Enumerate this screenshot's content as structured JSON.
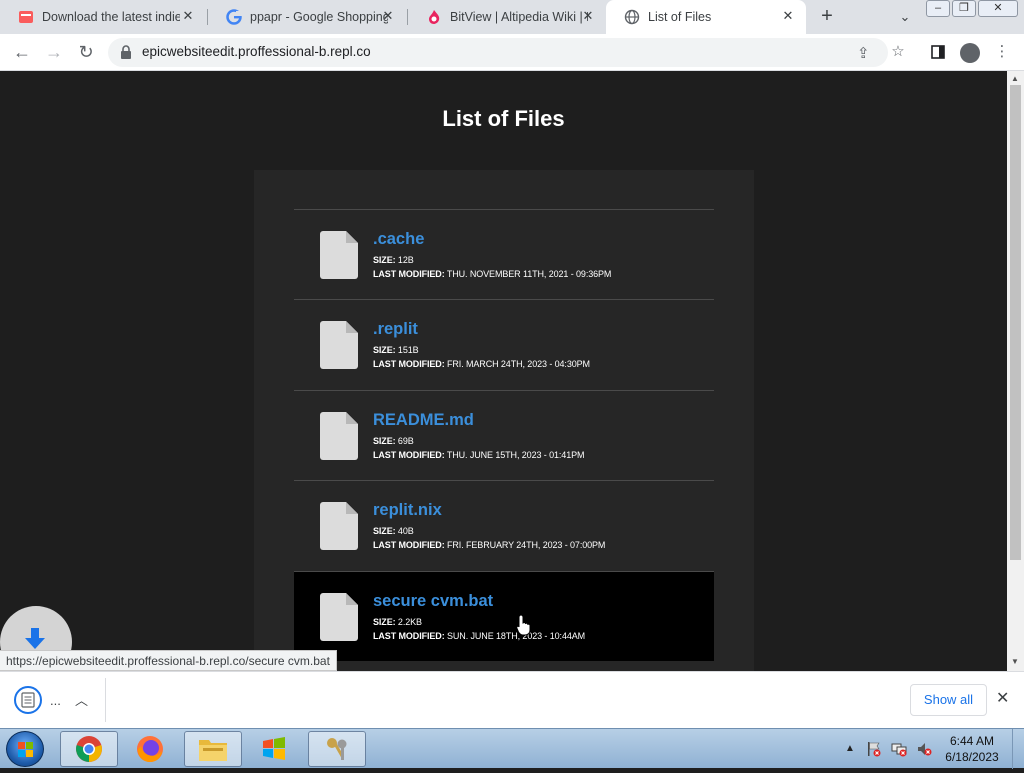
{
  "browser": {
    "tabs": [
      {
        "title": "Download the latest indie",
        "active": false
      },
      {
        "title": "ppapr - Google Shopping",
        "active": false
      },
      {
        "title": "BitView | Altipedia Wiki | F",
        "active": false
      },
      {
        "title": "List of Files",
        "active": true
      }
    ],
    "url": "epicwebsiteedit.proffessional-b.repl.co"
  },
  "page": {
    "title": "List of Files",
    "size_label": "SIZE:",
    "modified_label": "LAST MODIFIED:",
    "files": [
      {
        "name": ".cache",
        "size": "12B",
        "modified": "THU. NOVEMBER 11TH, 2021 - 09:36PM"
      },
      {
        "name": ".replit",
        "size": "151B",
        "modified": "FRI. MARCH 24TH, 2023 - 04:30PM"
      },
      {
        "name": "README.md",
        "size": "69B",
        "modified": "THU. JUNE 15TH, 2023 - 01:41PM"
      },
      {
        "name": "replit.nix",
        "size": "40B",
        "modified": "FRI. FEBRUARY 24TH, 2023 - 07:00PM"
      },
      {
        "name": "secure cvm.bat",
        "size": "2.2KB",
        "modified": "SUN. JUNE 18TH, 2023 - 10:44AM"
      }
    ]
  },
  "status_url": "https://epicwebsiteedit.proffessional-b.repl.co/secure cvm.bat",
  "downloads": {
    "item_label": "...",
    "show_all": "Show all"
  },
  "taskbar": {
    "time": "6:44 AM",
    "date": "6/18/2023"
  },
  "colors": {
    "accent_link": "#3b8fdb",
    "page_bg": "#1e1e1e",
    "panel_bg": "#262626"
  }
}
